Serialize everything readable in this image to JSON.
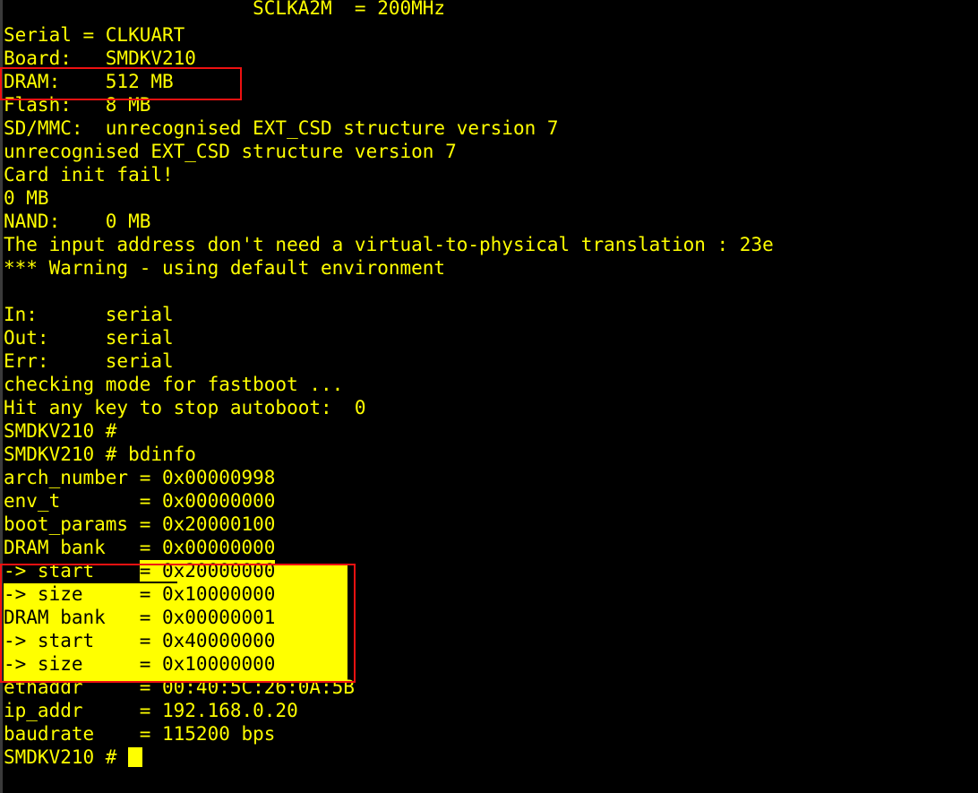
{
  "terminal": {
    "title": "U-Boot serial console",
    "prompt": "SMDKV210 #",
    "foreground_color": "#ffff00",
    "background_color": "#000000",
    "highlight_background": "#ffff00",
    "highlight_foreground": "#000000",
    "annotation_color": "#ee1111",
    "gutter_color": "#3a3a3a",
    "cursor": "block",
    "font_size_px": 21,
    "line_height_px": 26,
    "columns": 67,
    "rows": 34
  },
  "lines": [
    {
      "id": "clock-sclka2m",
      "text": "                      SCLKA2M  = 200MHz",
      "clipped": true
    },
    {
      "id": "serial",
      "text": "Serial = CLKUART"
    },
    {
      "id": "board",
      "text": "Board:   SMDKV210"
    },
    {
      "id": "dram",
      "text": "DRAM:    512 MB"
    },
    {
      "id": "flash",
      "text": "Flash:   8 MB"
    },
    {
      "id": "sdmmc",
      "text": "SD/MMC:  unrecognised EXT_CSD structure version 7"
    },
    {
      "id": "extcsd-warn",
      "text": "unrecognised EXT_CSD structure version 7"
    },
    {
      "id": "card-init-fail",
      "text": "Card init fail!"
    },
    {
      "id": "mmc-size",
      "text": "0 MB"
    },
    {
      "id": "nand",
      "text": "NAND:    0 MB"
    },
    {
      "id": "input-address",
      "text": "The input address don't need a virtual-to-physical translation : 23e"
    },
    {
      "id": "default-env-warning",
      "text": "*** Warning - using default environment"
    },
    {
      "id": "blank-1",
      "text": ""
    },
    {
      "id": "in",
      "text": "In:      serial"
    },
    {
      "id": "out",
      "text": "Out:     serial"
    },
    {
      "id": "err",
      "text": "Err:     serial"
    },
    {
      "id": "fastboot-check",
      "text": "checking mode for fastboot ..."
    },
    {
      "id": "autoboot",
      "text": "Hit any key to stop autoboot:  0"
    },
    {
      "id": "prompt-empty",
      "text": "SMDKV210 #"
    },
    {
      "id": "prompt-bdinfo",
      "text": "SMDKV210 # bdinfo"
    },
    {
      "id": "arch-number",
      "text": "arch_number = 0x00000998"
    },
    {
      "id": "env-t",
      "text": "env_t       = 0x00000000"
    },
    {
      "id": "boot-params",
      "text": "boot_params = 0x20000100"
    },
    {
      "id": "dram-bank-0",
      "text": "DRAM bank   = 0x00000000"
    },
    {
      "id": "bank0-start",
      "text": "-> start    = 0x20000000",
      "select_from": 12
    },
    {
      "id": "bank0-size",
      "text": "-> size     = 0x10000000",
      "select_from": 0
    },
    {
      "id": "dram-bank-1",
      "text": "DRAM bank   = 0x00000001",
      "select_from": 0
    },
    {
      "id": "bank1-start",
      "text": "-> start    = 0x40000000",
      "select_from": 0
    },
    {
      "id": "bank1-size",
      "text": "-> size     = 0x10000000",
      "select_from": 0
    },
    {
      "id": "ethaddr",
      "text": "ethaddr     = 00:40:5C:26:0A:5B"
    },
    {
      "id": "ip-addr",
      "text": "ip_addr     = 192.168.0.20"
    },
    {
      "id": "baudrate",
      "text": "baudrate    = 115200 bps"
    },
    {
      "id": "prompt-cursor",
      "text": "SMDKV210 # ",
      "cursor": true
    }
  ],
  "annotations": [
    {
      "id": "redbox-dram",
      "label": "DRAM size highlight box",
      "target": "DRAM:    512 MB"
    },
    {
      "id": "redbox-bank",
      "label": "DRAM bank address highlight box",
      "target": "DRAM bank start/size entries"
    }
  ]
}
